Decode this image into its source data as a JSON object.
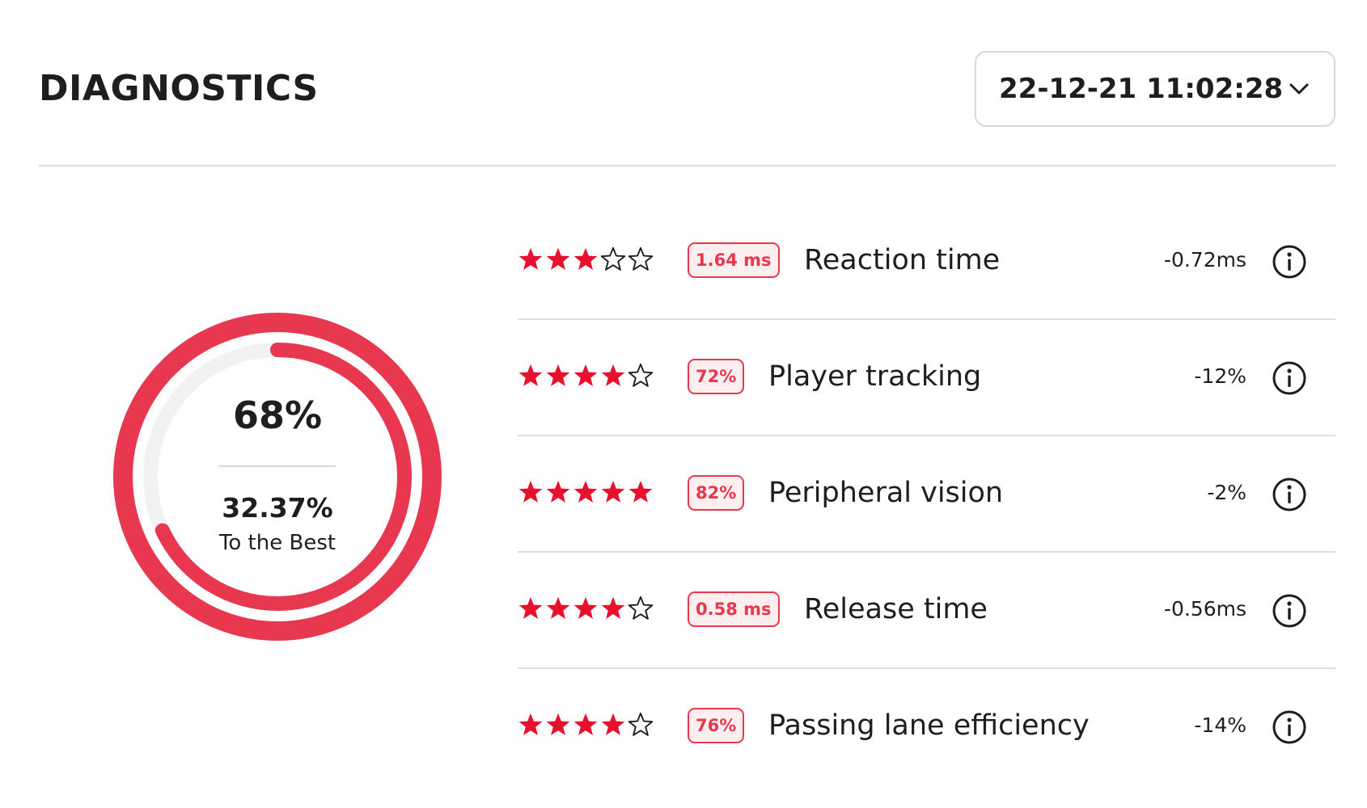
{
  "header": {
    "title": "DIAGNOSTICS",
    "date_select": {
      "value": "22-12-21 11:02:28",
      "icon": "chevron-down-icon"
    }
  },
  "summary": {
    "score": "68%",
    "score_fraction": 0.68,
    "to_best_value": "32.37%",
    "to_best_label": "To the Best"
  },
  "metrics": [
    {
      "rating": 3,
      "max_rating": 5,
      "badge": "1.64 ms",
      "name": "Reaction time",
      "delta": "-0.72ms"
    },
    {
      "rating": 4,
      "max_rating": 5,
      "badge": "72%",
      "name": "Player tracking",
      "delta": "-12%"
    },
    {
      "rating": 5,
      "max_rating": 5,
      "badge": "82%",
      "name": "Peripheral vision",
      "delta": "-2%"
    },
    {
      "rating": 4,
      "max_rating": 5,
      "badge": "0.58 ms",
      "name": "Release time",
      "delta": "-0.56ms"
    },
    {
      "rating": 4,
      "max_rating": 5,
      "badge": "76%",
      "name": "Passing lane efficiency",
      "delta": "-14%"
    }
  ],
  "colors": {
    "accent": "#e8384f",
    "star": "#e8112d",
    "badge_bg": "#fdeef0",
    "track": "#f2f2f2",
    "text": "#1e1e1e",
    "divider": "#dedede"
  }
}
